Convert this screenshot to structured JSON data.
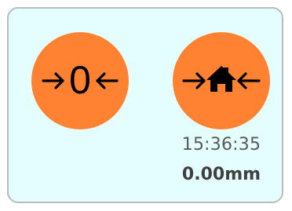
{
  "panel": {
    "zero_button": {
      "label": "0",
      "icon": "zero-arrows-icon"
    },
    "home_button": {
      "icon": "home-arrows-icon"
    },
    "status": {
      "time": "15:36:35",
      "position": "0.00mm"
    }
  },
  "colors": {
    "button_fill": "#ff8132",
    "panel_background": "#e4fdfd",
    "panel_border": "#b9bcbc",
    "glyph": "#000000"
  }
}
